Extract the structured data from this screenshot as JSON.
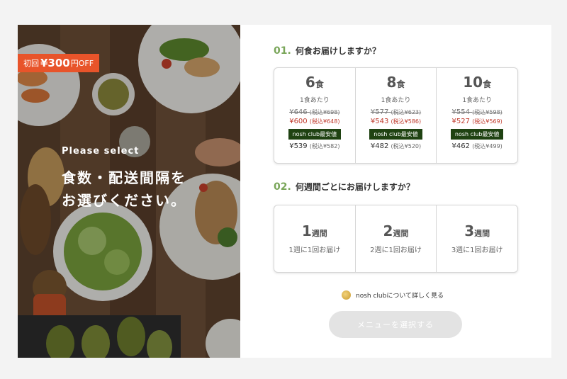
{
  "promo": {
    "prefix": "初回",
    "amount": "¥300",
    "suffix": "円OFF"
  },
  "hero": {
    "subtitle": "Please select",
    "title_line1": "食数・配送間隔を",
    "title_line2": "お選びください。"
  },
  "q1": {
    "num": "01.",
    "title": "何食お届けしますか？",
    "options": [
      {
        "count": "6",
        "unit": "食",
        "per": "1食あたり",
        "orig": "¥646",
        "orig_tax": "(税込¥698)",
        "disc": "¥600",
        "disc_tax": "(税込¥648)",
        "badge": "nosh club最安値",
        "club": "¥539",
        "club_tax": "(税込¥582)"
      },
      {
        "count": "8",
        "unit": "食",
        "per": "1食あたり",
        "orig": "¥577",
        "orig_tax": "(税込¥623)",
        "disc": "¥543",
        "disc_tax": "(税込¥586)",
        "badge": "nosh club最安値",
        "club": "¥482",
        "club_tax": "(税込¥520)"
      },
      {
        "count": "10",
        "unit": "食",
        "per": "1食あたり",
        "orig": "¥554",
        "orig_tax": "(税込¥598)",
        "disc": "¥527",
        "disc_tax": "(税込¥569)",
        "badge": "nosh club最安値",
        "club": "¥462",
        "club_tax": "(税込¥499)"
      }
    ]
  },
  "q2": {
    "num": "02.",
    "title": "何週間ごとにお届けしますか？",
    "options": [
      {
        "count": "1",
        "unit": "週間",
        "desc": "1週に1回お届け"
      },
      {
        "count": "2",
        "unit": "週間",
        "desc": "2週に1回お届け"
      },
      {
        "count": "3",
        "unit": "週間",
        "desc": "3週に1回お届け"
      }
    ]
  },
  "club_link": "nosh clubについて詳しく見る",
  "cta": "メニューを選択する",
  "colors": {
    "accent_green": "#7aa65a",
    "promo_orange": "#e8542a",
    "badge_green": "#1f4212",
    "price_red": "#c0392b"
  }
}
